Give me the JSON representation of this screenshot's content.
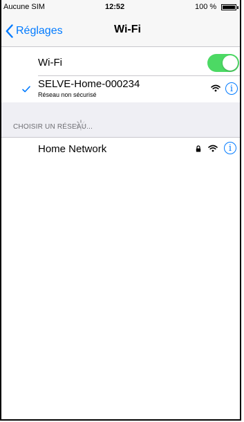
{
  "status_bar": {
    "carrier": "Aucune SIM",
    "time": "12:52",
    "battery": "100 %",
    "battery_level": 1.0
  },
  "nav": {
    "back_label": "Réglages",
    "title": "Wi-Fi"
  },
  "wifi_toggle": {
    "label": "Wi-Fi",
    "on": true,
    "on_color": "#4cd964"
  },
  "connected_network": {
    "name": "SELVE-Home-000234",
    "subtitle": "Réseau non sécurisé",
    "icons": [
      "checkmark-icon",
      "wifi-signal-icon",
      "info-icon"
    ]
  },
  "networks_section": {
    "header": "CHOISIR UN RÉSEAU..."
  },
  "networks": [
    {
      "name": "Home Network",
      "icons": [
        "lock-icon",
        "wifi-signal-icon",
        "info-icon"
      ]
    }
  ],
  "colors": {
    "accent": "#007aff",
    "group_background": "#efeff4"
  }
}
